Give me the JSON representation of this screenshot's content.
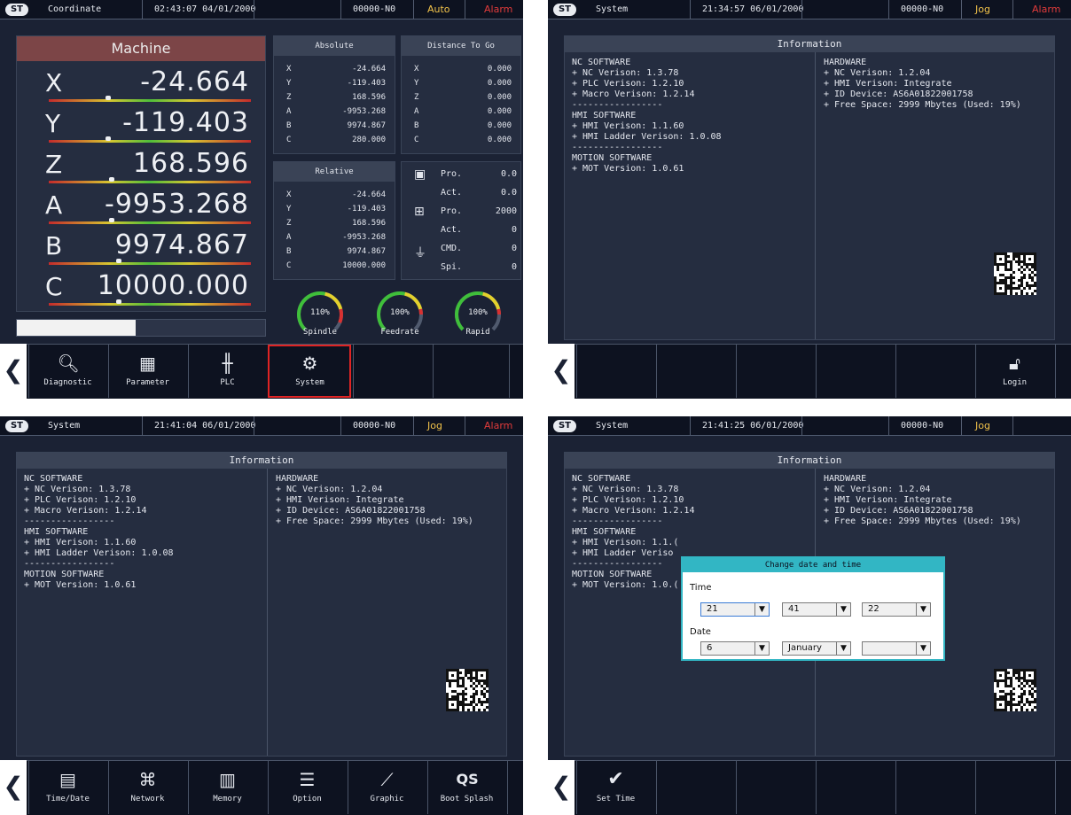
{
  "panel1": {
    "title": "Coordinate",
    "time": "02:43:07 04/01/2000",
    "program": "00000-N0",
    "mode": "Auto",
    "alarm": "Alarm",
    "machine_title": "Machine",
    "axes": [
      {
        "name": "X",
        "value": "-24.664"
      },
      {
        "name": "Y",
        "value": "-119.403"
      },
      {
        "name": "Z",
        "value": "168.596"
      },
      {
        "name": "A",
        "value": "-9953.268"
      },
      {
        "name": "B",
        "value": "9974.867"
      },
      {
        "name": "C",
        "value": "10000.000"
      }
    ],
    "progress_fraction": 0.48,
    "absolute": {
      "title": "Absolute",
      "rows": [
        {
          "k": "X",
          "v": "-24.664"
        },
        {
          "k": "Y",
          "v": "-119.403"
        },
        {
          "k": "Z",
          "v": "168.596"
        },
        {
          "k": "A",
          "v": "-9953.268"
        },
        {
          "k": "B",
          "v": "9974.867"
        },
        {
          "k": "C",
          "v": "280.000"
        }
      ]
    },
    "distance": {
      "title": "Distance To Go",
      "rows": [
        {
          "k": "X",
          "v": "0.000"
        },
        {
          "k": "Y",
          "v": "0.000"
        },
        {
          "k": "Z",
          "v": "0.000"
        },
        {
          "k": "A",
          "v": "0.000"
        },
        {
          "k": "B",
          "v": "0.000"
        },
        {
          "k": "C",
          "v": "0.000"
        }
      ]
    },
    "relative": {
      "title": "Relative",
      "rows": [
        {
          "k": "X",
          "v": "-24.664"
        },
        {
          "k": "Y",
          "v": "-119.403"
        },
        {
          "k": "Z",
          "v": "168.596"
        },
        {
          "k": "A",
          "v": "-9953.268"
        },
        {
          "k": "B",
          "v": "9974.867"
        },
        {
          "k": "C",
          "v": "10000.000"
        }
      ]
    },
    "feed": [
      {
        "k": "Pro.",
        "v": "0.0"
      },
      {
        "k": "Act.",
        "v": "0.0"
      },
      {
        "k": "Pro.",
        "v": "2000"
      },
      {
        "k": "Act.",
        "v": "0"
      },
      {
        "k": "CMD.",
        "v": "0"
      },
      {
        "k": "Spi.",
        "v": "0"
      }
    ],
    "gauges": [
      {
        "label": "Spindle",
        "pct": "110%",
        "level": 1.1
      },
      {
        "label": "Feedrate",
        "pct": "100%",
        "level": 1.0
      },
      {
        "label": "Rapid",
        "pct": "100%",
        "level": 1.0
      }
    ],
    "buttons": [
      "Diagnostic",
      "Parameter",
      "PLC",
      "System"
    ]
  },
  "panel2": {
    "title": "System",
    "time": "21:34:57 06/01/2000",
    "program": "00000-N0",
    "mode": "Jog",
    "alarm": "Alarm",
    "info_title": "Information",
    "login": "Login"
  },
  "panel3": {
    "title": "System",
    "time": "21:41:04 06/01/2000",
    "program": "00000-N0",
    "mode": "Jog",
    "alarm": "Alarm",
    "info_title": "Information",
    "buttons": [
      "Time/Date",
      "Network",
      "Memory",
      "Option",
      "Graphic",
      "Boot Splash"
    ]
  },
  "panel4": {
    "title": "System",
    "time": "21:41:25 06/01/2000",
    "program": "00000-N0",
    "mode": "Jog",
    "info_title": "Information",
    "set_time": "Set Time",
    "dialog": {
      "title": "Change date and time",
      "time_label": "Time",
      "date_label": "Date",
      "hour": "21",
      "minute": "41",
      "second": "22",
      "day": "6",
      "month": "January",
      "year": ""
    }
  },
  "info": {
    "left": "NC SOFTWARE\n+ NC Verison: 1.3.78\n+ PLC Verison: 1.2.10\n+ Macro Verison: 1.2.14\n-----------------\nHMI SOFTWARE\n+ HMI Verison: 1.1.60\n+ HMI Ladder Verison: 1.0.08\n-----------------\nMOTION SOFTWARE\n+ MOT Version: 1.0.61",
    "right": "HARDWARE\n+ NC Verison: 1.2.04\n+ HMI Verison: Integrate\n+ ID Device: AS6A01822001758\n+ Free Space: 2999 Mbytes (Used: 19%)",
    "left4": "NC SOFTWARE\n+ NC Verison: 1.3.78\n+ PLC Verison: 1.2.10\n+ Macro Verison: 1.2.14\n-----------------\nHMI SOFTWARE\n+ HMI Verison: 1.1.(\n+ HMI Ladder Veriso\n-----------------\nMOTION SOFTWARE\n+ MOT Version: 1.0.("
  },
  "logo_text": "ST",
  "colors": {
    "accent": "#32b6c4",
    "alarm": "#e13b3b",
    "mode": "#f2c34a",
    "machine_header": "#7c4547"
  }
}
